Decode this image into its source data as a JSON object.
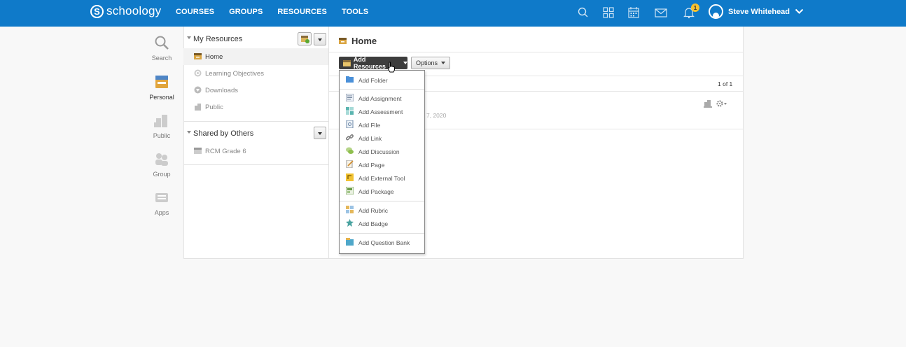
{
  "topbar": {
    "logo_letter": "S",
    "logo_text": "schoology",
    "nav": [
      "COURSES",
      "GROUPS",
      "RESOURCES",
      "TOOLS"
    ],
    "notification_count": "1",
    "user_name": "Steve Whitehead"
  },
  "leftnav": [
    {
      "label": "Search",
      "icon": "search-icon"
    },
    {
      "label": "Personal",
      "icon": "personal-icon",
      "active": true
    },
    {
      "label": "Public",
      "icon": "public-icon"
    },
    {
      "label": "Group",
      "icon": "group-icon"
    },
    {
      "label": "Apps",
      "icon": "apps-icon"
    }
  ],
  "sidepanel": {
    "my_resources": "My Resources",
    "items": [
      {
        "label": "Home",
        "active": true
      },
      {
        "label": "Learning Objectives"
      },
      {
        "label": "Downloads"
      },
      {
        "label": "Public"
      }
    ],
    "shared_by_others": "Shared by Others",
    "shared_items": [
      {
        "label": "RCM Grade 6"
      }
    ]
  },
  "main": {
    "title": "Home",
    "add_resources": "Add Resources",
    "options": "Options",
    "pager": "1 of 1",
    "date_fragment": "7, 2020"
  },
  "menu": {
    "groups": [
      [
        "Add Folder"
      ],
      [
        "Add Assignment",
        "Add Assessment",
        "Add File",
        "Add Link",
        "Add Discussion",
        "Add Page",
        "Add External Tool",
        "Add Package"
      ],
      [
        "Add Rubric",
        "Add Badge"
      ],
      [
        "Add Question Bank"
      ]
    ]
  },
  "colors": {
    "topbar": "#0f7ac9",
    "badge": "#f6c12d",
    "button_dark": "#3d3d3d"
  }
}
